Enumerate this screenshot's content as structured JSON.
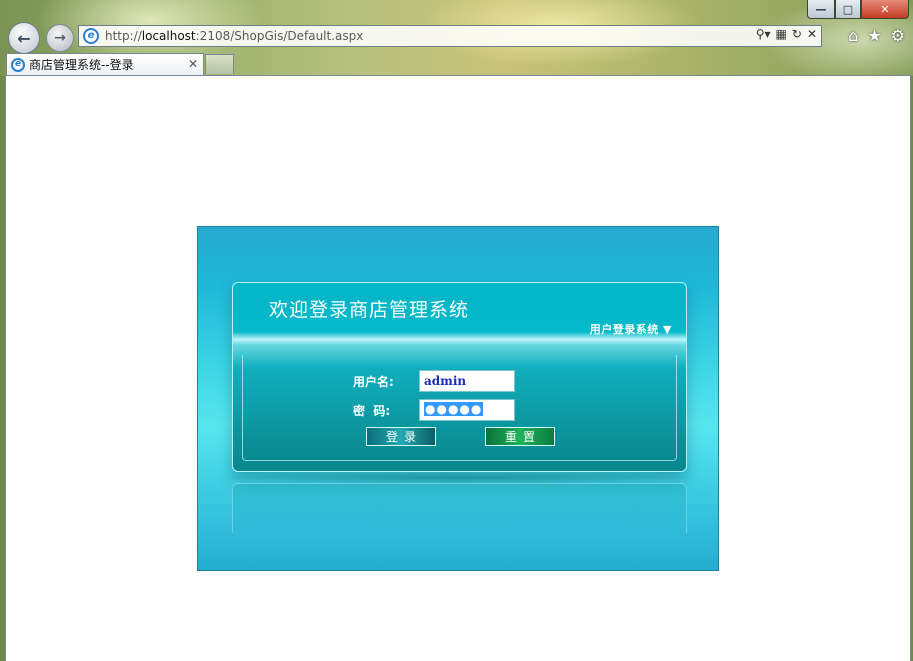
{
  "browser": {
    "url_prefix": "http://",
    "url_host": "localhost",
    "url_rest": ":2108/ShopGis/Default.aspx",
    "tab_title": "商店管理系统--登录",
    "icons": {
      "back": "back-arrow-icon",
      "forward": "forward-arrow-icon",
      "search": "search-icon",
      "compat": "compatibility-view-icon",
      "refresh": "refresh-icon",
      "stop": "close-icon",
      "home": "home-icon",
      "favorites": "star-icon",
      "tools": "gear-icon"
    }
  },
  "login": {
    "title": "欢迎登录商店管理系统",
    "subtitle": "用户登录系统 ▼",
    "username_label": "用户名:",
    "username_value": "admin",
    "password_label": "密  码:",
    "password_mask": "●●●●●",
    "login_button": "登录",
    "reset_button": "重置"
  }
}
